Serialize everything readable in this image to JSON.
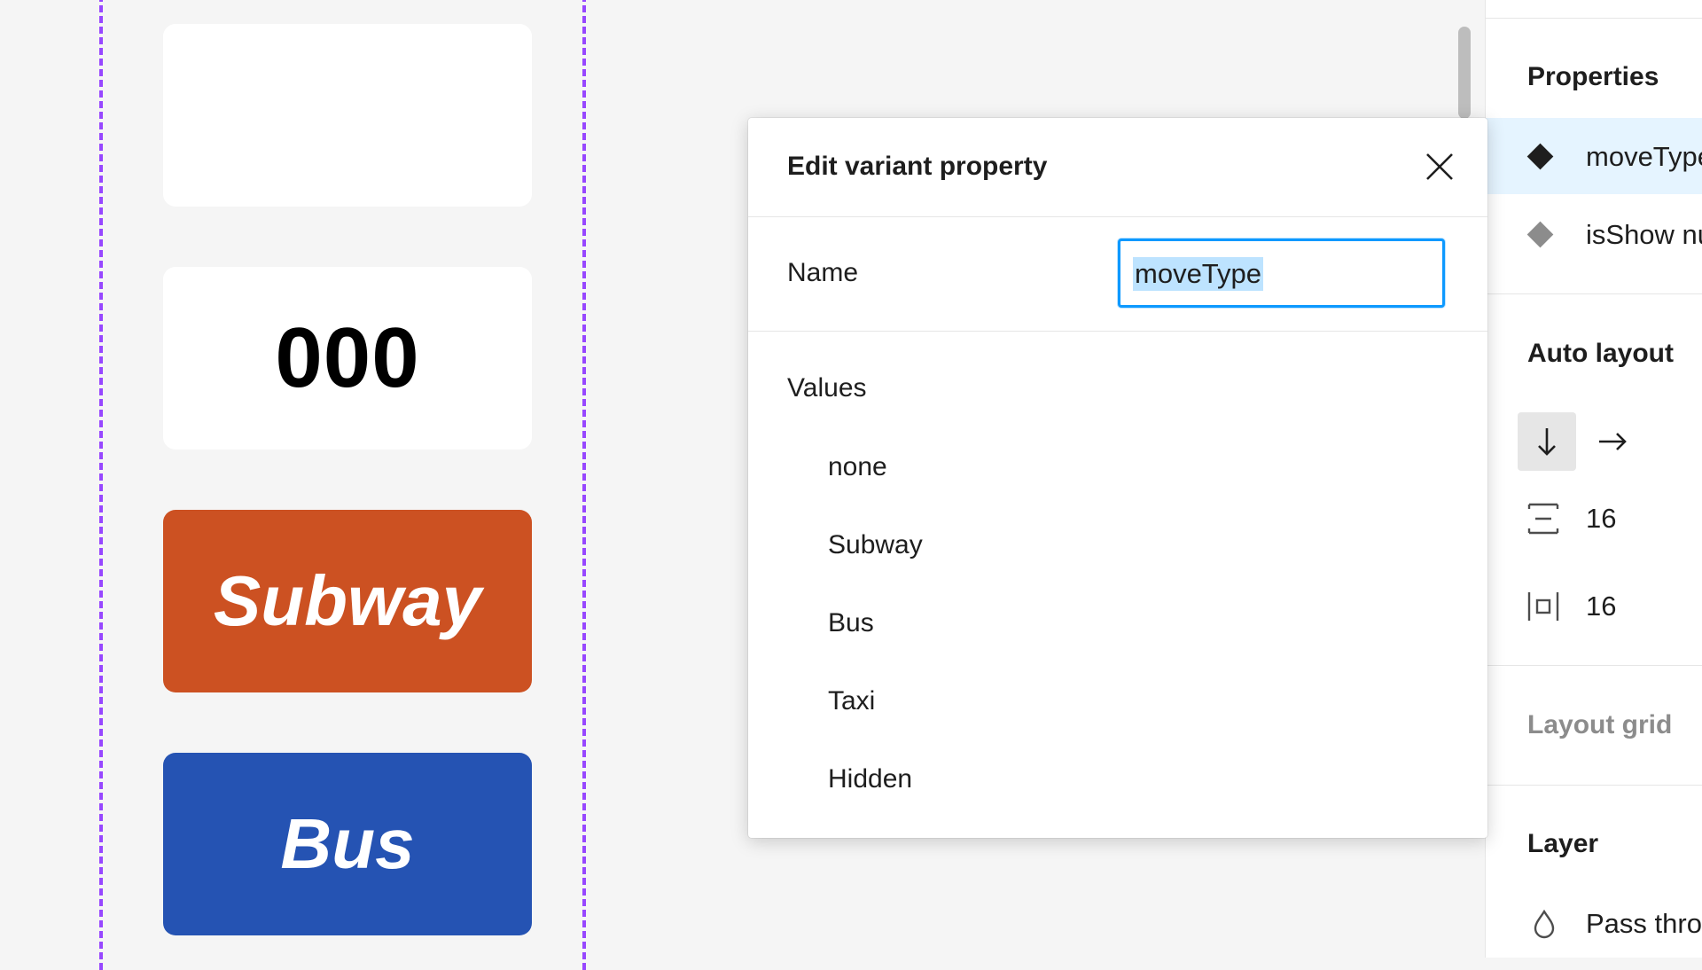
{
  "canvas": {
    "variants": {
      "number_text": "000",
      "subway_text": "Subway",
      "bus_text": "Bus"
    }
  },
  "dialog": {
    "title": "Edit variant property",
    "close_icon": "close-icon",
    "name_label": "Name",
    "name_value": "moveType",
    "values_title": "Values",
    "values": [
      "none",
      "Subway",
      "Bus",
      "Taxi",
      "Hidden"
    ]
  },
  "panel": {
    "properties_title": "Properties",
    "properties": [
      {
        "name": "moveType",
        "icon": "variant-diamond-icon"
      },
      {
        "name": "isShow nu",
        "icon": "variant-diamond-icon"
      }
    ],
    "auto_layout_title": "Auto layout",
    "direction_vertical_icon": "arrow-down-icon",
    "direction_horizontal_icon": "arrow-right-icon",
    "spacing_between": "16",
    "padding": "16",
    "layout_grid_title": "Layout grid",
    "layer_title": "Layer",
    "blend_mode": "Pass thro"
  },
  "colors": {
    "component_border": "#9747ff",
    "subway_bg": "#cc5122",
    "bus_bg": "#2553b3",
    "selection": "#0d99ff",
    "selected_row": "#e5f4ff"
  }
}
